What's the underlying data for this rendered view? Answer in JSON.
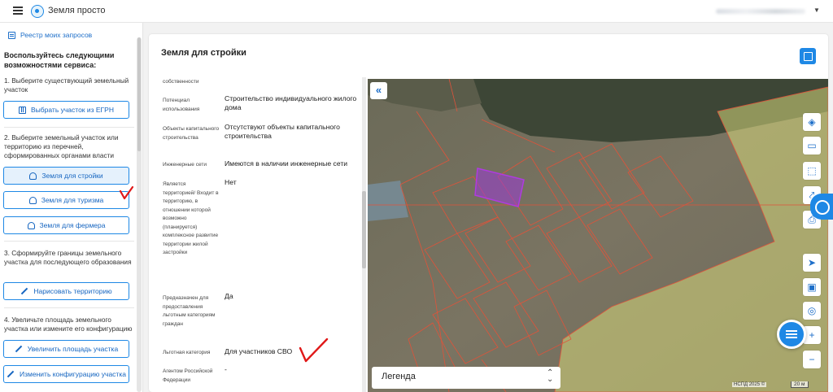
{
  "header": {
    "app_title": "Земля просто",
    "menu_icon": "hamburger-icon",
    "logo_icon": "globe-logo-icon"
  },
  "sidebar": {
    "registry_link": "Реестр моих запросов",
    "heading": "Воспользуйтесь следующими возможностями сервиса:",
    "step1": "1. Выберите существующий земельный участок",
    "btn_egrn": "Выбрать участок из ЕГРН",
    "step2": "2. Выберите земельный участок или территорию из перечней, сформированных органами власти",
    "btn_build": "Земля для стройки",
    "btn_tourism": "Земля для туризма",
    "btn_farmer": "Земля для фермера",
    "step3": "3. Сформируйте границы земельного участка для последующего образования",
    "btn_draw": "Нарисовать территорию",
    "step4": "4. Увеличьте площадь земельного участка или измените его конфигурацию",
    "btn_increase": "Увеличить площадь участка",
    "btn_config": "Изменить конфигурацию участка"
  },
  "panel": {
    "title": "Земля для стройки",
    "attributes": [
      {
        "key": "собственности",
        "value": ""
      },
      {
        "key": "Потенциал использования",
        "value": "Строительство индивидуального жилого дома"
      },
      {
        "key": "Объекты капитального строительства",
        "value": "Отсутствуют объекты капитального строительства"
      },
      {
        "key": "Инженерные сети",
        "value": "Имеются в наличии инженерные сети"
      },
      {
        "key": "Является территорией/ Входит в территорию, в отношении которой возможно (планируется) комплексное развитие территории жилой застройки",
        "value": "Нет"
      },
      {
        "key": "Предназначен для предоставления льготным категориям граждан",
        "value": "Да"
      },
      {
        "key": "Льготная категория",
        "value": "Для участников СВО"
      },
      {
        "key": "Агентом Российской Федерации",
        "value": "-"
      }
    ]
  },
  "map": {
    "collapse": "«",
    "legend": "Легенда",
    "legend_caret": "⌃⌄",
    "copyright": "НСПД 2025 ©",
    "scale": "20 м",
    "tools": [
      "layers-icon",
      "ruler-icon",
      "select-area-icon",
      "share-icon",
      "print-icon",
      "locate-icon",
      "screen-icon",
      "pin-icon",
      "zoom-in-icon",
      "zoom-out-icon"
    ],
    "colors": {
      "accent": "#1e88e5",
      "parcel_line": "#e0533a",
      "highlight": "#9b3bd6",
      "zone": "#d6d77a"
    }
  }
}
